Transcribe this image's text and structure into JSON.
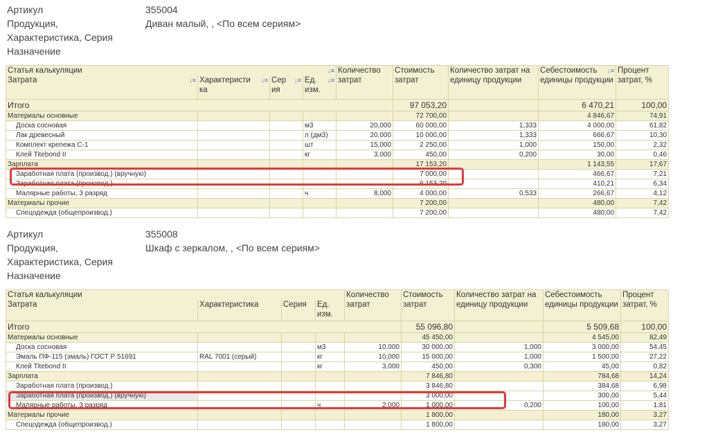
{
  "reports": [
    {
      "header": {
        "article_label": "Артикул",
        "article_value": "355004",
        "product_label": "Продукция,",
        "product_value": "Диван малый, , <По всем сериям>",
        "char_label": "Характеристика, Серия",
        "purpose_label": "Назначение"
      },
      "columns": {
        "calc_item": "Статья калькуляции",
        "cost": "Затрата",
        "characteristic": "Характеристи ка",
        "series": "Сер ия",
        "unit": "Ед. изм.",
        "qty": "Количество затрат",
        "amount": "Стоимость затрат",
        "qty_per_unit": "Количество затрат на единицу продукции",
        "unit_cost": "Себестоимость единицы продукции",
        "percent": "Процент затрат, %"
      },
      "total": {
        "label": "Итого",
        "amount": "97 053,20",
        "unit_cost": "6 470,21",
        "percent": "100,00"
      },
      "rows": [
        {
          "type": "group",
          "name": "Материалы основные",
          "char": "",
          "series": "",
          "unit": "",
          "qty": "",
          "amount": "72 700,00",
          "qpu": "",
          "uc": "4 846,67",
          "pct": "74,91"
        },
        {
          "type": "item",
          "name": "Доска сосновая",
          "char": "",
          "series": "",
          "unit": "м3",
          "qty": "20,000",
          "amount": "60 000,00",
          "qpu": "1,333",
          "uc": "4 000,00",
          "pct": "61,82"
        },
        {
          "type": "item",
          "name": "Лак древесный",
          "char": "",
          "series": "",
          "unit": "л (дм3)",
          "qty": "20,000",
          "amount": "10 000,00",
          "qpu": "1,333",
          "uc": "666,67",
          "pct": "10,30"
        },
        {
          "type": "item",
          "name": "Комплект крепежа С-1",
          "char": "",
          "series": "",
          "unit": "шт",
          "qty": "15,000",
          "amount": "2 250,00",
          "qpu": "1,000",
          "uc": "150,00",
          "pct": "2,32"
        },
        {
          "type": "item",
          "name": "Клей Titebond II",
          "char": "",
          "series": "",
          "unit": "кг",
          "qty": "3,000",
          "amount": "450,00",
          "qpu": "0,200",
          "uc": "30,00",
          "pct": "0,46"
        },
        {
          "type": "group",
          "name": "Зарплата",
          "char": "",
          "series": "",
          "unit": "",
          "qty": "",
          "amount": "17 153,20",
          "qpu": "",
          "uc": "1 143,55",
          "pct": "17,67"
        },
        {
          "type": "item",
          "name": "Заработная плата (производ.) (вручную)",
          "char": "",
          "series": "",
          "unit": "",
          "qty": "",
          "amount": "7 000,00",
          "qpu": "",
          "uc": "466,67",
          "pct": "7,21"
        },
        {
          "type": "item",
          "name": "Заработная плата (производ.)",
          "char": "",
          "series": "",
          "unit": "",
          "qty": "",
          "amount": "6 153,20",
          "qpu": "",
          "uc": "410,21",
          "pct": "6,34"
        },
        {
          "type": "item",
          "name": "Малярные работы, 3 разряд",
          "char": "",
          "series": "",
          "unit": "ч",
          "qty": "8,000",
          "amount": "4 000,00",
          "qpu": "0,533",
          "uc": "266,67",
          "pct": "4,12"
        },
        {
          "type": "group",
          "name": "Материалы прочие",
          "char": "",
          "series": "",
          "unit": "",
          "qty": "",
          "amount": "7 200,00",
          "qpu": "",
          "uc": "480,00",
          "pct": "7,42"
        },
        {
          "type": "item",
          "name": "Спецодежда (общепроизвод.)",
          "char": "",
          "series": "",
          "unit": "",
          "qty": "",
          "amount": "7 200,00",
          "qpu": "",
          "uc": "480,00",
          "pct": "7,42"
        }
      ]
    },
    {
      "header": {
        "article_label": "Артикул",
        "article_value": "355008",
        "product_label": "Продукция,",
        "product_value": "Шкаф с зеркалом, , <По всем сериям>",
        "char_label": "Характеристика, Серия",
        "purpose_label": "Назначение"
      },
      "columns": {
        "calc_item": "Статья калькуляции",
        "cost": "Затрата",
        "characteristic": "Характеристика",
        "series": "Серия",
        "unit": "Ед. изм.",
        "qty": "Количество затрат",
        "amount": "Стоимость затрат",
        "qty_per_unit": "Количество затрат на единицу продукции",
        "unit_cost": "Себестоимость единицы продукции",
        "percent": "Процент затрат, %"
      },
      "total": {
        "label": "Итого",
        "amount": "55 096,80",
        "unit_cost": "5 509,68",
        "percent": "100,00"
      },
      "rows": [
        {
          "type": "group",
          "name": "Материалы основные",
          "char": "",
          "series": "",
          "unit": "",
          "qty": "",
          "amount": "45 450,00",
          "qpu": "",
          "uc": "4 545,00",
          "pct": "82,49"
        },
        {
          "type": "item",
          "name": "Доска сосновая",
          "char": "",
          "series": "",
          "unit": "м3",
          "qty": "10,000",
          "amount": "30 000,00",
          "qpu": "1,000",
          "uc": "3 000,00",
          "pct": "54,45"
        },
        {
          "type": "item",
          "name": "Эмаль ПФ-115 (эмаль) ГОСТ Р 51691",
          "char": "RAL 7001 (серый)",
          "series": "",
          "unit": "кг",
          "qty": "10,000",
          "amount": "15 000,00",
          "qpu": "1,000",
          "uc": "1 500,00",
          "pct": "27,22"
        },
        {
          "type": "item",
          "name": "Клей Titebond II",
          "char": "",
          "series": "",
          "unit": "кг",
          "qty": "3,000",
          "amount": "450,00",
          "qpu": "0,300",
          "uc": "45,00",
          "pct": "0,82"
        },
        {
          "type": "group",
          "name": "Зарплата",
          "char": "",
          "series": "",
          "unit": "",
          "qty": "",
          "amount": "7 846,80",
          "qpu": "",
          "uc": "784,68",
          "pct": "14,24"
        },
        {
          "type": "item",
          "name": "Заработная плата (производ.)",
          "char": "",
          "series": "",
          "unit": "",
          "qty": "",
          "amount": "3 846,80",
          "qpu": "",
          "uc": "384,68",
          "pct": "6,98"
        },
        {
          "type": "item",
          "name": "Заработная плата (производ.) (вручную)",
          "char": "",
          "series": "",
          "unit": "",
          "qty": "",
          "amount": "3 000,00",
          "qpu": "",
          "uc": "300,00",
          "pct": "5,44"
        },
        {
          "type": "item",
          "name": "Малярные работы, 3 разряд",
          "char": "",
          "series": "",
          "unit": "ч",
          "qty": "2,000",
          "amount": "1 000,00",
          "qpu": "0,200",
          "uc": "100,00",
          "pct": "1,81"
        },
        {
          "type": "group",
          "name": "Материалы прочие",
          "char": "",
          "series": "",
          "unit": "",
          "qty": "",
          "amount": "1 800,00",
          "qpu": "",
          "uc": "180,00",
          "pct": "3,27"
        },
        {
          "type": "item",
          "name": "Спецодежда (общепроизвод.)",
          "char": "",
          "series": "",
          "unit": "",
          "qty": "",
          "amount": "1 800,00",
          "qpu": "",
          "uc": "180,00",
          "pct": "3,27"
        }
      ]
    }
  ],
  "icons": {
    "sort": "sort-icon"
  },
  "colors": {
    "header_bg": "#f4f1d3",
    "border": "#d9d3a8",
    "highlight": "#e03a3a"
  }
}
